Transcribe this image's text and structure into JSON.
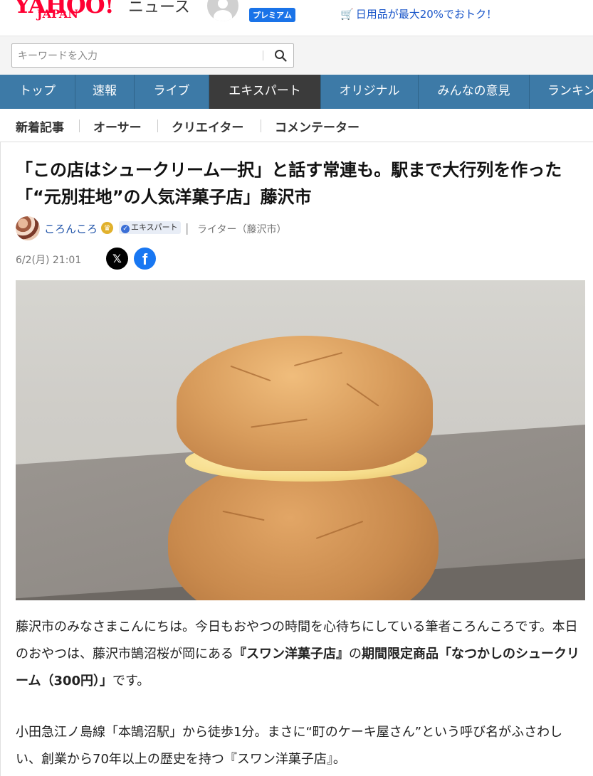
{
  "header": {
    "logo_main": "YAHOO!",
    "logo_sub": "JAPAN",
    "service": "ニュース",
    "premium": "プレミアム",
    "promo_top": "ー　 　　　 　　　　　",
    "promo": "日用品が最大20%でおトク！"
  },
  "search": {
    "placeholder": "キーワードを入力"
  },
  "nav": {
    "items": [
      "トップ",
      "速報",
      "ライブ",
      "エキスパート",
      "オリジナル",
      "みんなの意見",
      "ランキング"
    ],
    "active": "エキスパート"
  },
  "subnav": {
    "items": [
      "新着記事",
      "オーサー",
      "クリエイター",
      "コメンテーター"
    ]
  },
  "article": {
    "title": "「この店はシュークリーム一択」と話す常連も。駅まで大行列を作った「“元別荘地”の人気洋菓子店」藤沢市",
    "author": "ころんころ",
    "badge": "エキスパート",
    "separator": "|",
    "role": "ライター（藤沢市）",
    "date": "6/2(月) 21:01",
    "share_x": "𝕏",
    "share_fb": "f",
    "p1_a": "藤沢市のみなさまこんにちは。今日もおやつの時間を心待ちにしている筆者ころんころです。本日のおやつは、藤沢市鵠沼桜が岡にある",
    "p1_b": "『スワン洋菓子店』",
    "p1_c": "の",
    "p1_d": "期間限定商品「なつかしのシュークリーム（300円）」",
    "p1_e": "です。",
    "p2": "小田急江ノ島線「本鵠沼駅」から徒歩1分。まさに“町のケーキ屋さん”という呼び名がふさわしい、創業から70年以上の歴史を持つ『スワン洋菓子店』。"
  }
}
